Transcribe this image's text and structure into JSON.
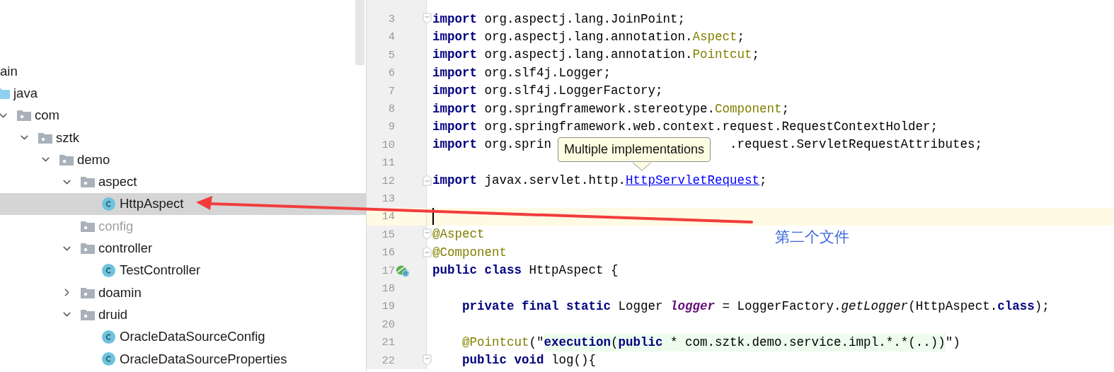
{
  "project_tree": [
    {
      "label": "ain",
      "kind": "source",
      "selected": false,
      "dimmed": false,
      "children": [
        {
          "label": "java",
          "kind": "sources",
          "selected": false,
          "dimmed": false,
          "children": [
            {
              "label": "com",
              "kind": "package",
              "expanded": true,
              "selected": false,
              "dimmed": false,
              "children": [
                {
                  "label": "sztk",
                  "kind": "package",
                  "expanded": true,
                  "selected": false,
                  "dimmed": false,
                  "children": [
                    {
                      "label": "demo",
                      "kind": "package",
                      "expanded": true,
                      "selected": false,
                      "dimmed": false,
                      "children": [
                        {
                          "label": "aspect",
                          "kind": "package",
                          "expanded": true,
                          "selected": false,
                          "dimmed": false,
                          "children": [
                            {
                              "label": "HttpAspect",
                              "kind": "class",
                              "selected": true,
                              "dimmed": false
                            }
                          ]
                        },
                        {
                          "label": "config",
                          "kind": "package",
                          "selected": false,
                          "dimmed": true
                        },
                        {
                          "label": "controller",
                          "kind": "package",
                          "expanded": true,
                          "selected": false,
                          "dimmed": false,
                          "children": [
                            {
                              "label": "TestController",
                              "kind": "class",
                              "selected": false,
                              "dimmed": false
                            }
                          ]
                        },
                        {
                          "label": "doamin",
                          "kind": "package",
                          "expanded": false,
                          "selected": false,
                          "dimmed": false
                        },
                        {
                          "label": "druid",
                          "kind": "package",
                          "expanded": true,
                          "selected": false,
                          "dimmed": false,
                          "children": [
                            {
                              "label": "OracleDataSourceConfig",
                              "kind": "class",
                              "selected": false,
                              "dimmed": false
                            },
                            {
                              "label": "OracleDataSourceProperties",
                              "kind": "class",
                              "selected": false,
                              "dimmed": false
                            }
                          ]
                        }
                      ]
                    }
                  ]
                }
              ]
            }
          ]
        }
      ]
    }
  ],
  "editor": {
    "lines": [
      {
        "n": "3",
        "current": false,
        "fold_start": true,
        "tokens": [
          {
            "kind": "kw",
            "text": "import"
          },
          {
            "kind": "plain",
            "text": " org.aspectj.lang.JoinPoint;"
          }
        ]
      },
      {
        "n": "4",
        "current": false,
        "tokens": [
          {
            "kind": "kw",
            "text": "import"
          },
          {
            "kind": "plain",
            "text": " org.aspectj.lang.annotation."
          },
          {
            "kind": "ann",
            "text": "Aspect"
          },
          {
            "kind": "plain",
            "text": ";"
          }
        ]
      },
      {
        "n": "5",
        "current": false,
        "tokens": [
          {
            "kind": "kw",
            "text": "import"
          },
          {
            "kind": "plain",
            "text": " org.aspectj.lang.annotation."
          },
          {
            "kind": "ann",
            "text": "Pointcut"
          },
          {
            "kind": "plain",
            "text": ";"
          }
        ]
      },
      {
        "n": "6",
        "current": false,
        "tokens": [
          {
            "kind": "kw",
            "text": "import"
          },
          {
            "kind": "plain",
            "text": " org.slf4j.Logger;"
          }
        ]
      },
      {
        "n": "7",
        "current": false,
        "tokens": [
          {
            "kind": "kw",
            "text": "import"
          },
          {
            "kind": "plain",
            "text": " org.slf4j.LoggerFactory;"
          }
        ]
      },
      {
        "n": "8",
        "current": false,
        "tokens": [
          {
            "kind": "kw",
            "text": "import"
          },
          {
            "kind": "plain",
            "text": " org.springframework.stereotype."
          },
          {
            "kind": "ann",
            "text": "Component"
          },
          {
            "kind": "plain",
            "text": ";"
          }
        ]
      },
      {
        "n": "9",
        "current": false,
        "tokens": [
          {
            "kind": "kw",
            "text": "import"
          },
          {
            "kind": "plain",
            "text": " org.springframework.web.context.request.RequestContextHolder;"
          }
        ]
      },
      {
        "n": "10",
        "current": false,
        "tokens": [
          {
            "kind": "kw",
            "text": "import"
          },
          {
            "kind": "plain",
            "text": " org.sprin",
            "covered_after": true
          },
          {
            "kind": "plain",
            "text": ".request.ServletRequestAttributes;"
          }
        ]
      },
      {
        "n": "11",
        "current": false
      },
      {
        "n": "12",
        "current": false,
        "fold_end": true,
        "tokens": [
          {
            "kind": "kw",
            "text": "import"
          },
          {
            "kind": "plain",
            "text": " javax.servlet.http."
          },
          {
            "kind": "link",
            "text": "HttpServletRequest"
          },
          {
            "kind": "plain",
            "text": ";"
          }
        ]
      },
      {
        "n": "13",
        "current": false
      },
      {
        "n": "14",
        "current": true
      },
      {
        "n": "15",
        "current": false,
        "fold_start": true,
        "tokens": [
          {
            "kind": "ann",
            "text": "@Aspect"
          }
        ]
      },
      {
        "n": "16",
        "current": false,
        "fold_end": true,
        "tokens": [
          {
            "kind": "ann",
            "text": "@Component"
          }
        ]
      },
      {
        "n": "17",
        "current": false,
        "implemented_marker": true,
        "tokens": [
          {
            "kind": "kw",
            "text": "public class"
          },
          {
            "kind": "plain",
            "text": " HttpAspect {"
          }
        ]
      },
      {
        "n": "18",
        "current": false
      },
      {
        "n": "19",
        "current": false,
        "indented": true,
        "tokens": [
          {
            "kind": "kw",
            "text": "private final static"
          },
          {
            "kind": "plain",
            "text": " Logger "
          },
          {
            "kind": "field",
            "text": "logger"
          },
          {
            "kind": "plain",
            "text": " = LoggerFactory."
          },
          {
            "kind": "method",
            "text": "getLogger"
          },
          {
            "kind": "plain",
            "text": "(HttpAspect."
          },
          {
            "kind": "kw",
            "text": "class"
          },
          {
            "kind": "plain",
            "text": ");"
          }
        ]
      },
      {
        "n": "20",
        "current": false
      },
      {
        "n": "21",
        "current": false,
        "indented": true,
        "tokens": [
          {
            "kind": "ann",
            "text": "@Pointcut"
          },
          {
            "kind": "plain",
            "text": "(\""
          },
          {
            "kind": "injkw",
            "text": "execution"
          },
          {
            "kind": "inj",
            "text": "("
          },
          {
            "kind": "injkw",
            "text": "public"
          },
          {
            "kind": "inj",
            "text": " * com.sztk.demo.service.impl.*.*(..))"
          },
          {
            "kind": "plain",
            "text": "\")"
          }
        ]
      },
      {
        "n": "22",
        "current": false,
        "indented": true,
        "fold_start": true,
        "tokens": [
          {
            "kind": "kw",
            "text": "public void"
          },
          {
            "kind": "plain",
            "text": " log(){"
          }
        ]
      }
    ]
  },
  "tooltip": {
    "text": "Multiple implementations"
  },
  "annotation": {
    "text": "第二个文件"
  }
}
